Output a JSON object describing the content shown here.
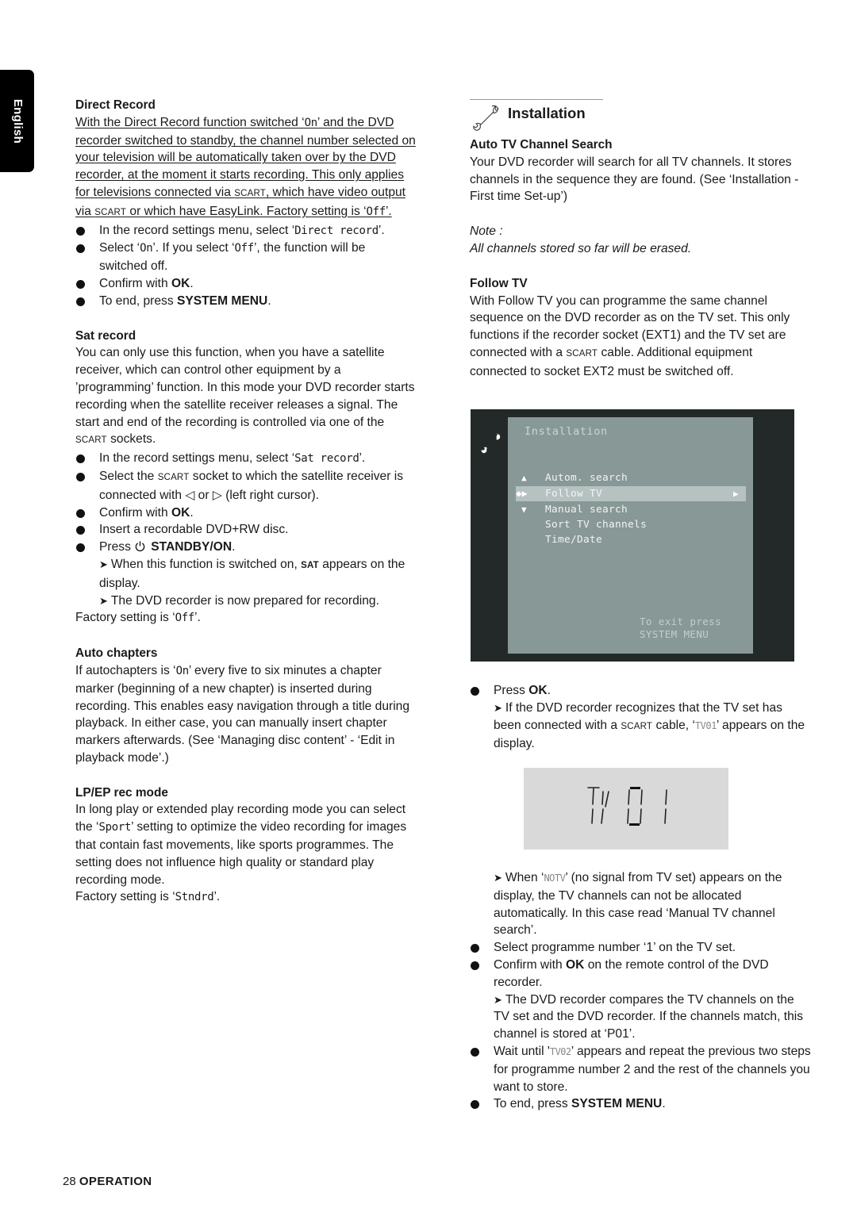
{
  "language_tab": "English",
  "left": {
    "direct_record": {
      "title": "Direct Record",
      "intro_1": "With the Direct Record function switched ‘",
      "intro_on": "On",
      "intro_2": "’ and the DVD recorder switched to standby, the channel number selected on your television will be automatically taken over by the DVD recorder, at the moment it starts recording. This only applies for televisions connected via ",
      "scart1": "SCART",
      "intro_3": ", which have video output via ",
      "scart2": "SCART",
      "intro_4": " or which have EasyLink. Factory setting is ‘",
      "intro_off": "Off",
      "intro_5": "’.",
      "b1_pre": "In the record settings menu, select ‘",
      "b1_lcd": "Direct record",
      "b1_post": "’.",
      "b2_pre": "Select ‘",
      "b2_on": "On",
      "b2_mid": "’. If you select ‘",
      "b2_off": "Off",
      "b2_post": "’, the function will be switched off.",
      "b3_pre": "Confirm with ",
      "b3_bold": "OK",
      "b3_post": ".",
      "b4_pre": "To end, press ",
      "b4_bold": "SYSTEM MENU",
      "b4_post": "."
    },
    "sat_record": {
      "title": "Sat record",
      "intro_1": "You can only use this function, when you have a satellite receiver, which can control other equipment by a ’programming’ function. In this mode your DVD recorder starts recording when the satellite receiver releases a signal. The start and end of the recording is controlled via one of the ",
      "scart": "SCART",
      "intro_2": " sockets.",
      "b1_pre": "In the record settings menu, select ‘",
      "b1_lcd": "Sat record",
      "b1_post": "’.",
      "b2_pre": "Select the ",
      "b2_scart": "SCART",
      "b2_post": " socket to which the satellite receiver is connected with ◁ or ▷ (left right cursor).",
      "b3_pre": "Confirm with ",
      "b3_bold": "OK",
      "b3_post": ".",
      "b4": "Insert a recordable DVD+RW disc.",
      "b5_pre": "Press ",
      "b5_bold": "STANDBY/ON",
      "b5_post": ".",
      "r1_pre": "When this function is switched on, ",
      "r1_bold": "SAT",
      "r1_post": " appears on the display.",
      "r2": "The DVD recorder is now prepared for recording.",
      "factory_pre": "Factory setting is ‘",
      "factory_val": "Off",
      "factory_post": "’."
    },
    "auto_chapters": {
      "title": "Auto chapters",
      "text_1": "If autochapters is ‘",
      "text_on": "On",
      "text_2": "’ every five to six minutes a chapter marker (beginning of a new chapter) is inserted during recording. This enables easy navigation through a title during playback. In either case, you can manually insert chapter markers afterwards. (See ‘Managing disc content’ - ‘Edit in playback mode’.)"
    },
    "lp_ep": {
      "title": "LP/EP rec mode",
      "text_1": "In long play or extended play recording mode you can select the ‘",
      "text_lcd": "Sport",
      "text_2": "’ setting to optimize the video recording for images that contain fast movements, like sports programmes. The setting does not influence high quality or standard play recording mode.",
      "factory_pre": "Factory setting is ‘",
      "factory_val": "Stndrd",
      "factory_post": "’."
    }
  },
  "right": {
    "section_title": "Installation",
    "auto_tv": {
      "title": "Auto TV Channel Search",
      "text": "Your DVD recorder will search for all TV channels. It stores channels in the sequence they are found. (See ‘Installation - First time Set-up’)",
      "note_label": "Note :",
      "note_text": "All channels stored so far will be erased."
    },
    "follow_tv": {
      "title": "Follow TV",
      "text_1": "With Follow TV you can programme the same channel sequence on the DVD recorder as on the TV set. This only functions if the recorder socket (EXT1) and the TV set are connected with a ",
      "scart": "SCART",
      "text_2": " cable. Additional equipment connected to socket EXT2 must be switched off."
    },
    "osd_menu": {
      "title": "Installation",
      "items": [
        {
          "label": "Autom. search",
          "icon": "up-triangle-icon"
        },
        {
          "label": "Follow TV",
          "icon": "navigate-icon",
          "selected": true
        },
        {
          "label": "Manual search",
          "icon": "down-triangle-icon"
        },
        {
          "label": "Sort TV channels"
        },
        {
          "label": "Time/Date"
        }
      ],
      "exit_line1": "To exit press",
      "exit_line2": "SYSTEM MENU",
      "colors": {
        "frame": "#232928",
        "panel": "#879896",
        "highlight": "#b6c2bf"
      }
    },
    "steps": {
      "s1_pre": "Press ",
      "s1_bold": "OK",
      "s1_post": ".",
      "r1_pre": "If the DVD recorder recognizes that the TV set has been connected with a ",
      "r1_scart": "SCART",
      "r1_mid": " cable, ‘",
      "r1_lcd": "TV01",
      "r1_post": "’ appears on the display.",
      "lcd_display": "TV 01",
      "r2_pre": "When ‘",
      "r2_lcd": "NOTV",
      "r2_post": "’ (no signal from TV set) appears on the display, the TV channels can not be allocated automatically. In this case read ‘Manual TV channel search’.",
      "s2": "Select programme number ‘1’ on the TV set.",
      "s3_pre": "Confirm with ",
      "s3_bold": "OK",
      "s3_post": " on the remote control of the DVD recorder.",
      "r3": "The DVD recorder compares the TV channels on the TV set and the DVD recorder. If the channels match, this channel is stored at ‘P01’.",
      "s4_pre": "Wait until '",
      "s4_lcd": "TV02",
      "s4_post": "’ appears and repeat the previous two steps for programme number 2 and the rest of the channels you want to store.",
      "s5_pre": "To end, press ",
      "s5_bold": "SYSTEM MENU",
      "s5_post": "."
    }
  },
  "footer": {
    "page_number": "28",
    "section": "OPERATION"
  }
}
